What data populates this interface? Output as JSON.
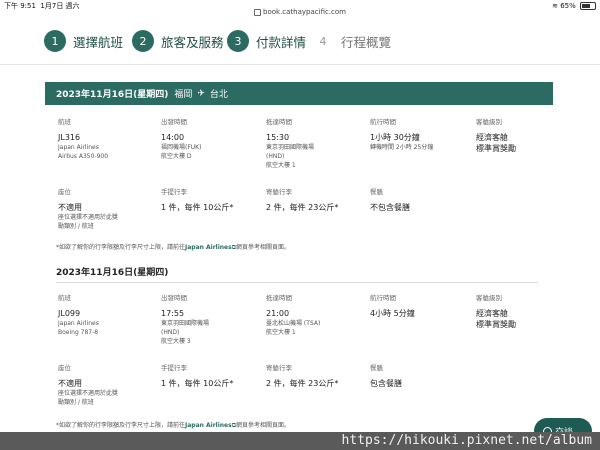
{
  "status_bar": {
    "time": "下午 9:51",
    "date": "1月7日 週六",
    "url": "book.cathaypacific.com",
    "battery": "65%",
    "battery_level": 0.65
  },
  "stepper": [
    {
      "num": "1",
      "label": "選擇航班"
    },
    {
      "num": "2",
      "label": "旅客及服務"
    },
    {
      "num": "3",
      "label": "付款詳情"
    },
    {
      "num": "4",
      "label": "行程概覽"
    }
  ],
  "flight1": {
    "header_date": "2023年11月16日(星期四)",
    "from": "福岡",
    "to": "台北",
    "col_flight": {
      "h": "航班",
      "v": "JL316",
      "s1": "Japan Airlines",
      "s2": "Airbus A350-900"
    },
    "col_dep": {
      "h": "出發時間",
      "v": "14:00",
      "s1": "福岡機場(FUK)",
      "s2": "航空大樓 D"
    },
    "col_arr": {
      "h": "抵達時間",
      "v": "15:30",
      "s1": "東京羽田國際機場",
      "s2": "(HND)",
      "s3": "航空大樓 1"
    },
    "col_dur": {
      "h": "航行時間",
      "v": "1小時 30分鐘",
      "s1": "轉機時間 2小時 25分鐘"
    },
    "col_cls": {
      "h": "客艙級別",
      "v1": "經濟客艙",
      "v2": "標準賞獎勵"
    },
    "seat": {
      "h": "座位",
      "v": "不適用",
      "s1": "座位選擇不適用於此獎",
      "s2": "勵類別 / 航班"
    },
    "carry": {
      "h": "手提行李",
      "v": "1 件，每件 10公斤*"
    },
    "checked": {
      "h": "寄艙行李",
      "v": "2 件，每件 23公斤*"
    },
    "meal": {
      "h": "餐膳",
      "v": "不包含餐膳"
    }
  },
  "note1": {
    "text1": "*如欲了解你的行李限額及行李尺寸上限，請前往",
    "link": "Japan Airlines",
    "text2": "網頁參考相關頁面。"
  },
  "flight2": {
    "title": "2023年11月16日(星期四)",
    "col_flight": {
      "h": "航班",
      "v": "JL099",
      "s1": "Japan Airlines",
      "s2": "Boeing 787-8"
    },
    "col_dep": {
      "h": "出發時間",
      "v": "17:55",
      "s1": "東京羽田國際機場",
      "s2": "(HND)",
      "s3": "航空大樓 3"
    },
    "col_arr": {
      "h": "抵達時間",
      "v": "21:00",
      "s1": "臺北松山機場 (TSA)",
      "s2": "航空大樓 1"
    },
    "col_dur": {
      "h": "航行時間",
      "v": "4小時 5分鐘"
    },
    "col_cls": {
      "h": "客艙級別",
      "v1": "經濟客艙",
      "v2": "標準賞獎勵"
    },
    "seat": {
      "h": "座位",
      "v": "不適用",
      "s1": "座位選擇不適用於此獎",
      "s2": "勵類別 / 航班"
    },
    "carry": {
      "h": "手提行李",
      "v": "1 件，每件 10公斤*"
    },
    "checked": {
      "h": "寄艙行李",
      "v": "2 件，每件 23公斤*"
    },
    "meal": {
      "h": "餐膳",
      "v": "包含餐膳"
    }
  },
  "note2": {
    "text1": "*如欲了解你的行李限額及行李尺寸上限，請前往",
    "link": "Japan Airlines",
    "text2": "網頁參考相關頁面。"
  },
  "chat": {
    "label": "交談"
  },
  "watermark": "https://hikouki.pixnet.net/album"
}
